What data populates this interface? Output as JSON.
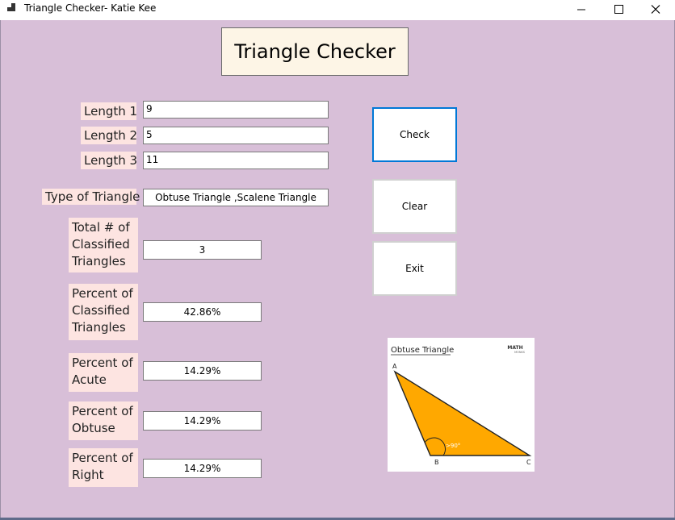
{
  "window": {
    "title": "Triangle Checker- Katie Kee"
  },
  "heading": "Triangle Checker",
  "inputs": {
    "length1": {
      "label": "Length 1",
      "value": "9"
    },
    "length2": {
      "label": "Length 2",
      "value": "5"
    },
    "length3": {
      "label": "Length 3",
      "value": "11"
    }
  },
  "type_of_triangle": {
    "label": "Type of Triangle",
    "value": "Obtuse Triangle ,Scalene Triangle"
  },
  "stats": {
    "total": {
      "label": "Total # of Classified Triangles",
      "value": "3"
    },
    "percent_classified": {
      "label": "Percent of Classified Triangles",
      "value": "42.86%"
    },
    "percent_acute": {
      "label": "Percent of Acute",
      "value": "14.29%"
    },
    "percent_obtuse": {
      "label": "Percent of Obtuse",
      "value": "14.29%"
    },
    "percent_right": {
      "label": "Percent of Right",
      "value": "14.29%"
    }
  },
  "buttons": {
    "check": "Check",
    "clear": "Clear",
    "exit": "Exit"
  },
  "image": {
    "title": "Obtuse Triangle",
    "logo_line1": "MATH",
    "logo_line2": "MONKS",
    "angle_label": ">90°",
    "vertex_a": "A",
    "vertex_b": "B",
    "vertex_c": "C",
    "triangle_fill": "#ffa800"
  },
  "colors": {
    "background": "#d8bfd8",
    "label_bg": "#fde4e1",
    "heading_bg": "#fdf5e6",
    "focus_border": "#0078d7"
  }
}
